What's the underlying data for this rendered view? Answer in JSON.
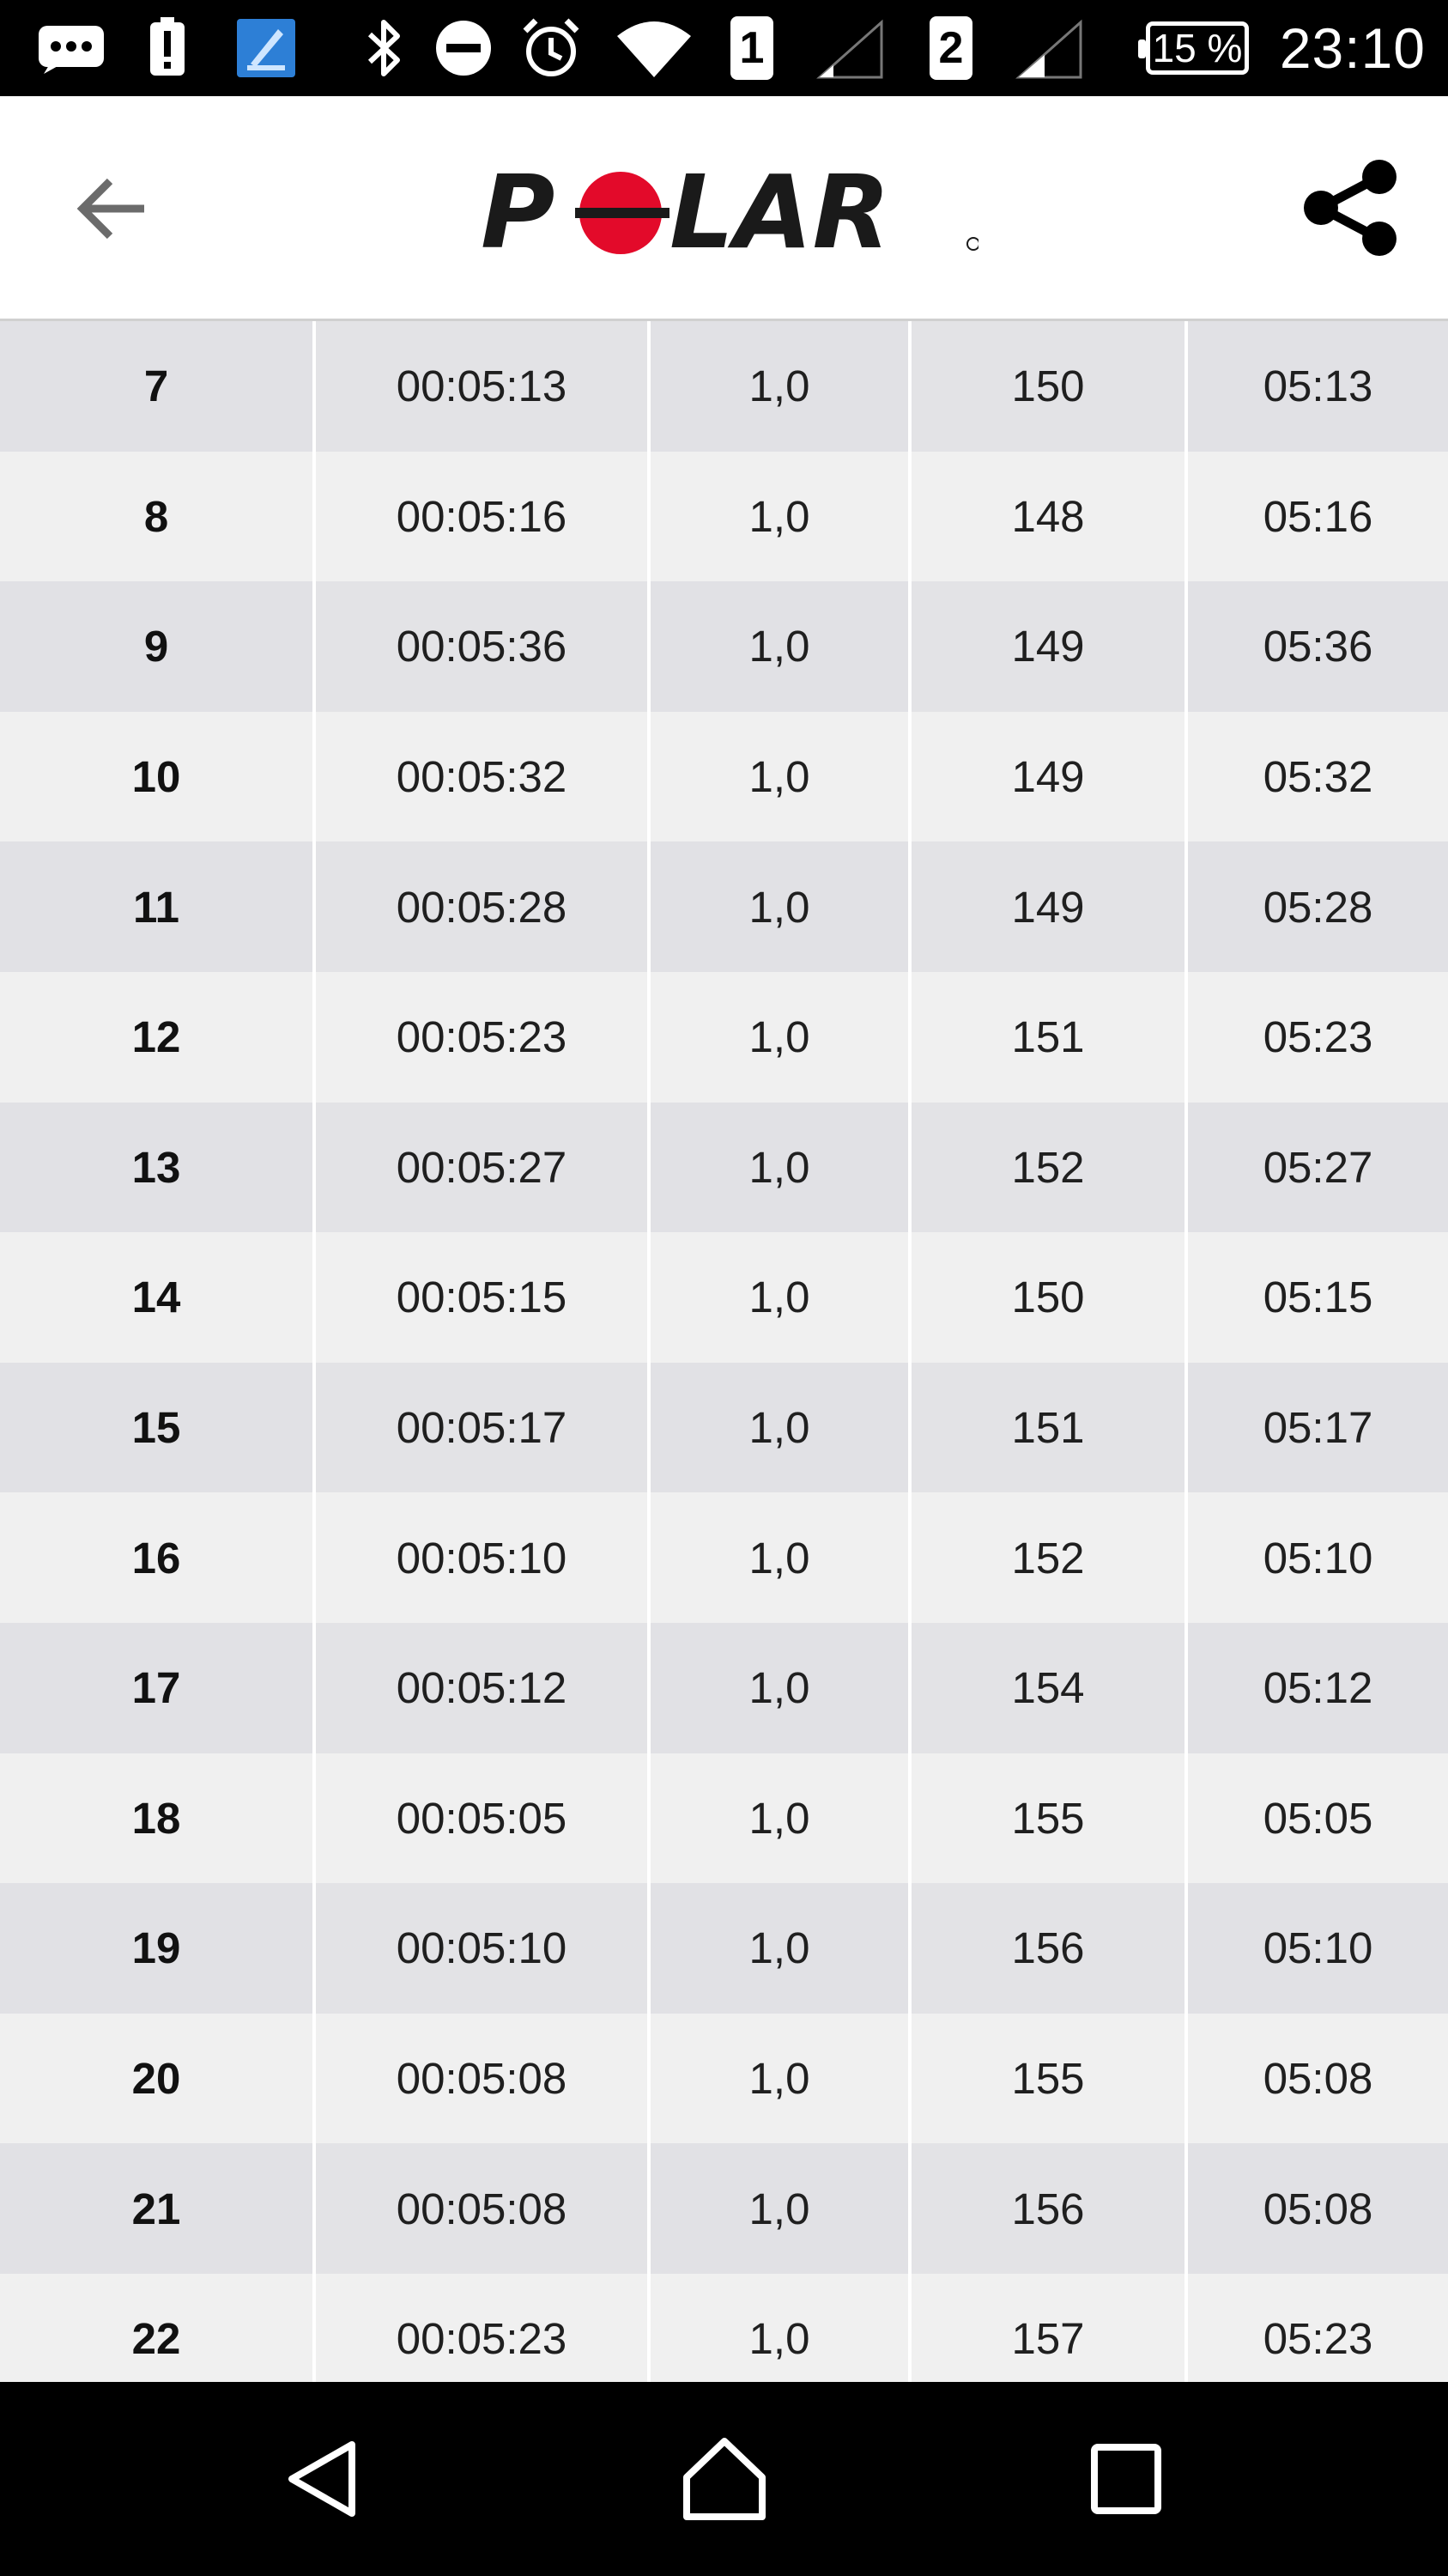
{
  "status_bar": {
    "sim1_label": "1",
    "sim2_label": "2",
    "battery_text": "15 %",
    "time": "23:10",
    "icons": [
      "chat-icon",
      "alert-icon",
      "app-icon",
      "bluetooth-icon",
      "dnd-icon",
      "alarm-icon",
      "wifi-icon",
      "signal-icon",
      "signal-icon",
      "battery-icon"
    ]
  },
  "app_bar": {
    "logo_text": "POLAR",
    "logo_color": "#e30a2a",
    "icons": [
      "back-arrow-icon",
      "share-icon"
    ]
  },
  "laps_table": {
    "rows": [
      {
        "lap": "7",
        "duration": "00:05:13",
        "distance": "1,0",
        "hr": "150",
        "pace": "05:13"
      },
      {
        "lap": "8",
        "duration": "00:05:16",
        "distance": "1,0",
        "hr": "148",
        "pace": "05:16"
      },
      {
        "lap": "9",
        "duration": "00:05:36",
        "distance": "1,0",
        "hr": "149",
        "pace": "05:36"
      },
      {
        "lap": "10",
        "duration": "00:05:32",
        "distance": "1,0",
        "hr": "149",
        "pace": "05:32"
      },
      {
        "lap": "11",
        "duration": "00:05:28",
        "distance": "1,0",
        "hr": "149",
        "pace": "05:28"
      },
      {
        "lap": "12",
        "duration": "00:05:23",
        "distance": "1,0",
        "hr": "151",
        "pace": "05:23"
      },
      {
        "lap": "13",
        "duration": "00:05:27",
        "distance": "1,0",
        "hr": "152",
        "pace": "05:27"
      },
      {
        "lap": "14",
        "duration": "00:05:15",
        "distance": "1,0",
        "hr": "150",
        "pace": "05:15"
      },
      {
        "lap": "15",
        "duration": "00:05:17",
        "distance": "1,0",
        "hr": "151",
        "pace": "05:17"
      },
      {
        "lap": "16",
        "duration": "00:05:10",
        "distance": "1,0",
        "hr": "152",
        "pace": "05:10"
      },
      {
        "lap": "17",
        "duration": "00:05:12",
        "distance": "1,0",
        "hr": "154",
        "pace": "05:12"
      },
      {
        "lap": "18",
        "duration": "00:05:05",
        "distance": "1,0",
        "hr": "155",
        "pace": "05:05"
      },
      {
        "lap": "19",
        "duration": "00:05:10",
        "distance": "1,0",
        "hr": "156",
        "pace": "05:10"
      },
      {
        "lap": "20",
        "duration": "00:05:08",
        "distance": "1,0",
        "hr": "155",
        "pace": "05:08"
      },
      {
        "lap": "21",
        "duration": "00:05:08",
        "distance": "1,0",
        "hr": "156",
        "pace": "05:08"
      },
      {
        "lap": "22",
        "duration": "00:05:23",
        "distance": "1,0",
        "hr": "157",
        "pace": "05:23"
      }
    ]
  },
  "nav_bar": {
    "icons": [
      "nav-back-icon",
      "nav-home-icon",
      "nav-recents-icon"
    ]
  }
}
